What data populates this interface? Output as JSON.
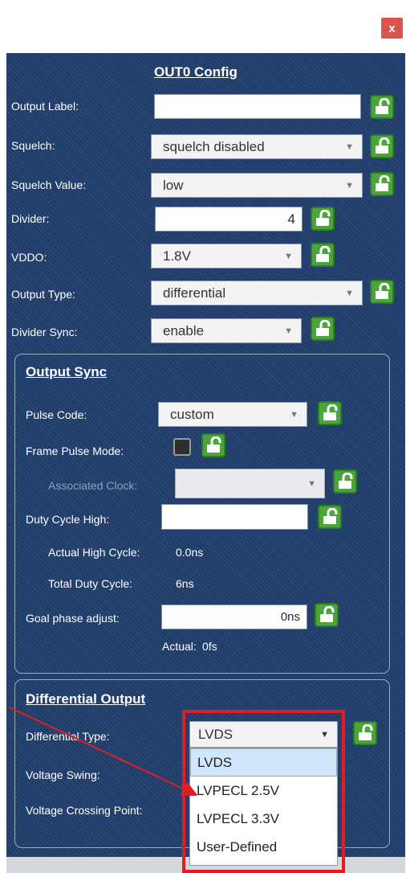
{
  "window": {
    "close_label": "x"
  },
  "panel_title": "OUT0 Config",
  "fields": {
    "output_label": {
      "label": "Output Label:",
      "value": ""
    },
    "squelch": {
      "label": "Squelch:",
      "value": "squelch disabled"
    },
    "squelch_value": {
      "label": "Squelch Value:",
      "value": "low"
    },
    "divider": {
      "label": "Divider:",
      "value": "4"
    },
    "vddo": {
      "label": "VDDO:",
      "value": "1.8V"
    },
    "output_type": {
      "label": "Output Type:",
      "value": "differential"
    },
    "divider_sync": {
      "label": "Divider Sync:",
      "value": "enable"
    }
  },
  "output_sync": {
    "title": "Output Sync",
    "pulse_code": {
      "label": "Pulse Code:",
      "value": "custom"
    },
    "frame_pulse_mode": {
      "label": "Frame Pulse Mode:"
    },
    "associated_clock": {
      "label": "Associated Clock:",
      "value": ""
    },
    "duty_cycle_high": {
      "label": "Duty Cycle High:",
      "value": ""
    },
    "actual_high_cycle": {
      "label": "Actual High Cycle:",
      "value": "0.0ns"
    },
    "total_duty_cycle": {
      "label": "Total Duty Cycle:",
      "value": "6ns"
    },
    "goal_phase_adjust": {
      "label": "Goal phase adjust:",
      "value": "0ns"
    },
    "actual": {
      "label": "Actual:",
      "value": "0fs"
    }
  },
  "differential_output": {
    "title": "Differential Output",
    "differential_type": {
      "label": "Differential Type:",
      "value": "LVDS"
    },
    "voltage_swing": {
      "label": "Voltage Swing:"
    },
    "voltage_crossing_point": {
      "label": "Voltage Crossing Point:"
    },
    "options": [
      "LVDS",
      "LVPECL 2.5V",
      "LVPECL 3.3V",
      "User-Defined"
    ],
    "selected_option": "LVDS"
  },
  "colors": {
    "panel_bg": "#203f6b",
    "lock_green": "#4aa63a",
    "highlight_red": "#e31b23",
    "close_red": "#d9534f"
  }
}
